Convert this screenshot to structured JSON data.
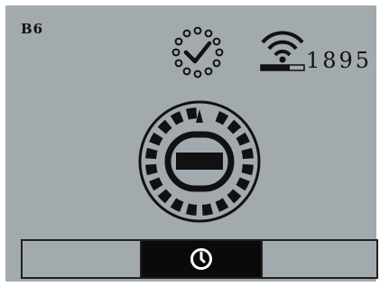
{
  "header": {
    "code": "B6",
    "counter": "1895"
  },
  "icons": {
    "status": "loading-check-icon",
    "signal": "wifi-signal-icon",
    "dial": "compass-dial-icon",
    "selected_tab": "clock-icon"
  },
  "colors": {
    "screen": "#a2aaad",
    "ink": "#111111",
    "selected_bg": "#0a0a0a",
    "selected_fg": "#ffffff"
  },
  "bottom_bar": {
    "selected_index": 1,
    "segments": [
      "",
      "",
      ""
    ]
  }
}
